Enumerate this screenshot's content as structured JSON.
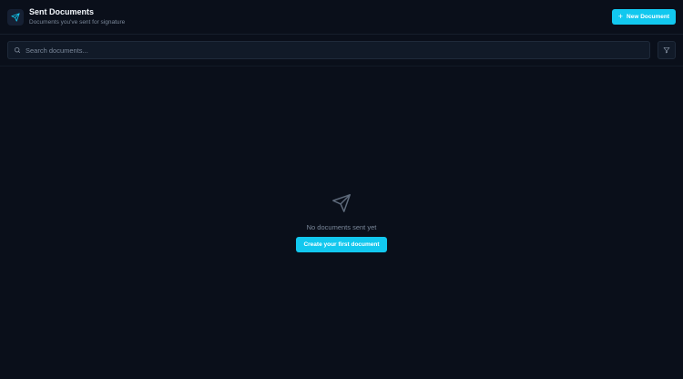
{
  "header": {
    "title": "Sent Documents",
    "subtitle": "Documents you've sent for signature",
    "icon": "send-icon",
    "new_button_label": "New Document",
    "new_button_icon": "plus-icon"
  },
  "search": {
    "placeholder": "Search documents...",
    "value": "",
    "icon": "search-icon",
    "filter_icon": "filter-icon"
  },
  "empty_state": {
    "icon": "send-icon",
    "message": "No documents sent yet",
    "cta_label": "Create your first document"
  },
  "colors": {
    "background": "#0a0f1a",
    "accent": "#12c8ef",
    "muted_text": "#7a8799"
  }
}
